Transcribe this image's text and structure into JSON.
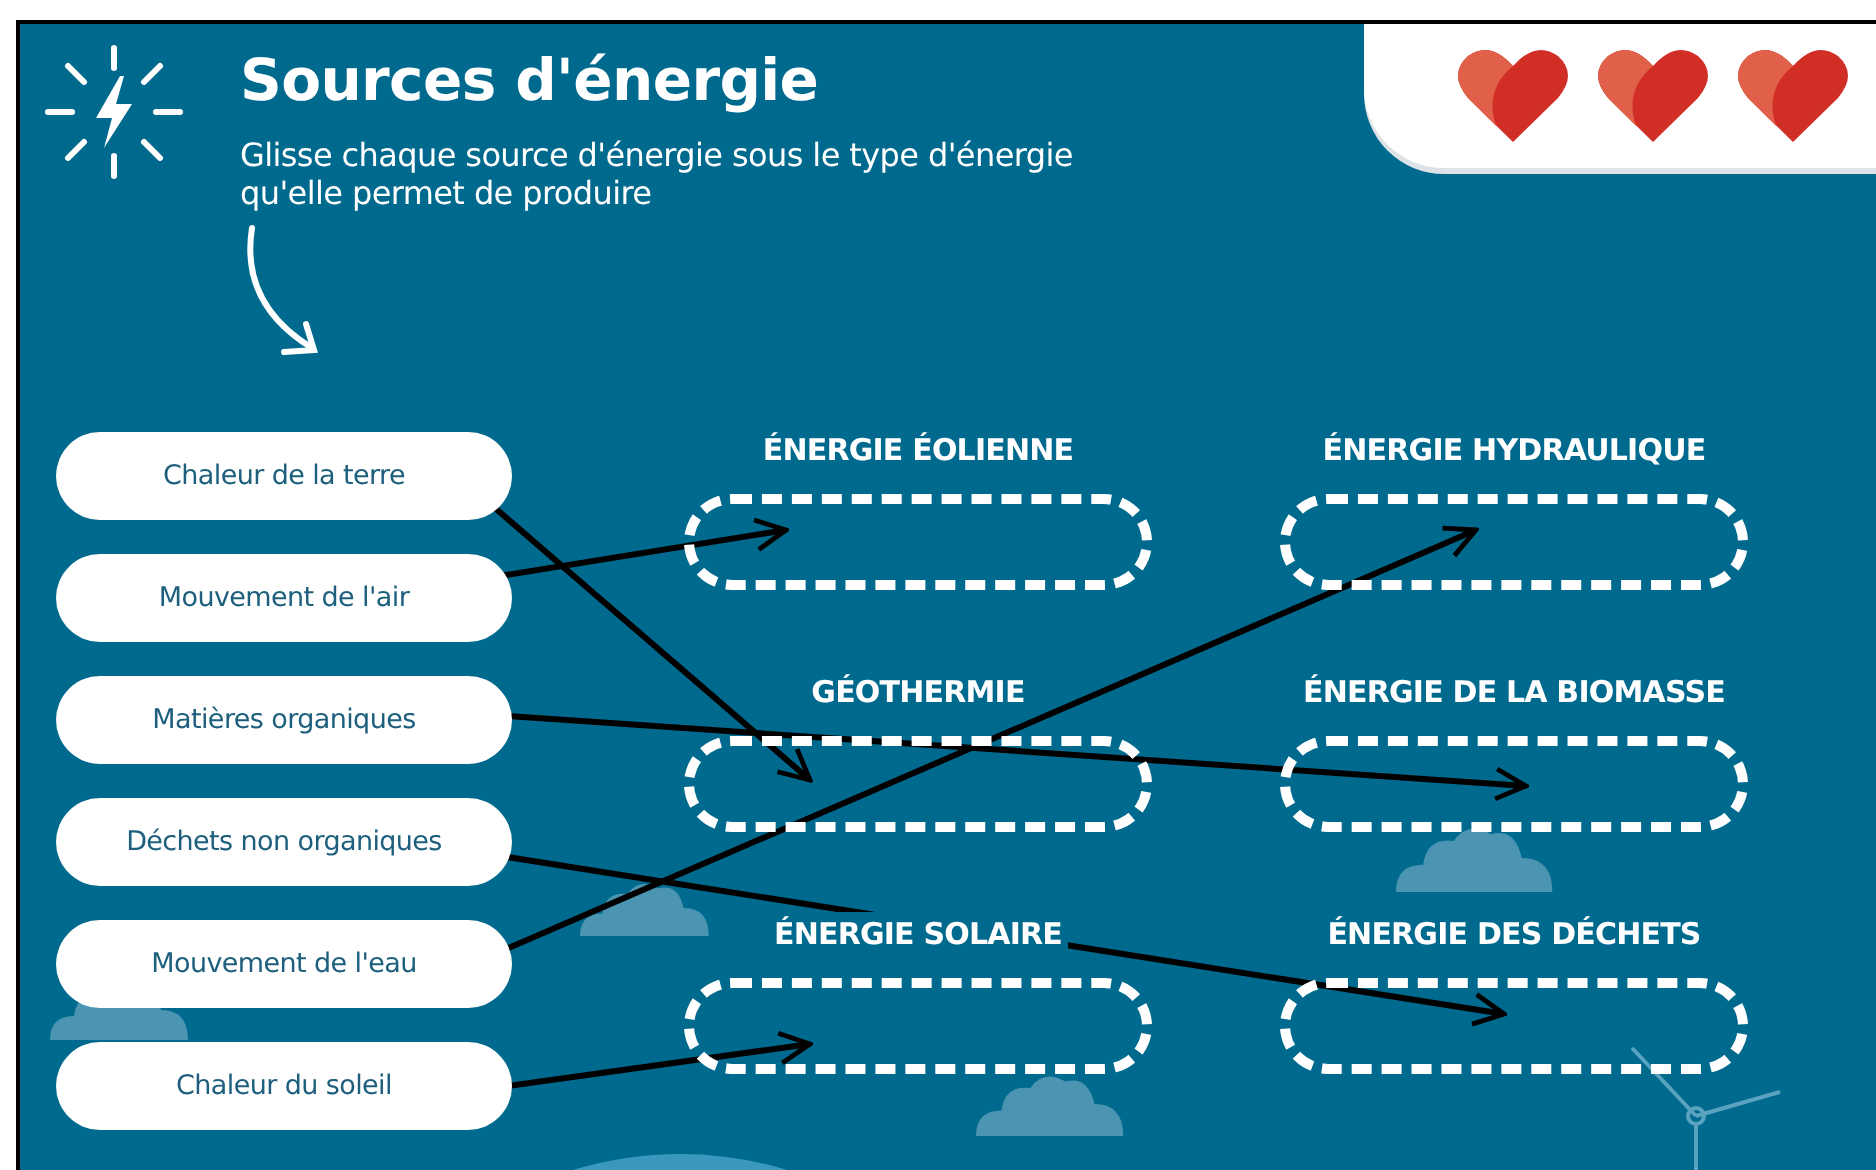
{
  "header": {
    "title": "Sources d'énergie",
    "instruction": "Glisse chaque source d'énergie sous le type d'énergie qu'elle permet de produire"
  },
  "lives": [
    {
      "filled": true
    },
    {
      "filled": true
    },
    {
      "filled": true
    }
  ],
  "sources": [
    {
      "label": "Chaleur de la terre"
    },
    {
      "label": "Mouvement de l'air"
    },
    {
      "label": "Matières organiques"
    },
    {
      "label": "Déchets non organiques"
    },
    {
      "label": "Mouvement de l'eau"
    },
    {
      "label": "Chaleur du soleil"
    }
  ],
  "targets": [
    {
      "label": "ÉNERGIE ÉOLIENNE"
    },
    {
      "label": "ÉNERGIE HYDRAULIQUE"
    },
    {
      "label": "GÉOTHERMIE"
    },
    {
      "label": "ÉNERGIE DE LA BIOMASSE"
    },
    {
      "label": "ÉNERGIE SOLAIRE"
    },
    {
      "label": "ÉNERGIE DES DÉCHETS"
    }
  ]
}
